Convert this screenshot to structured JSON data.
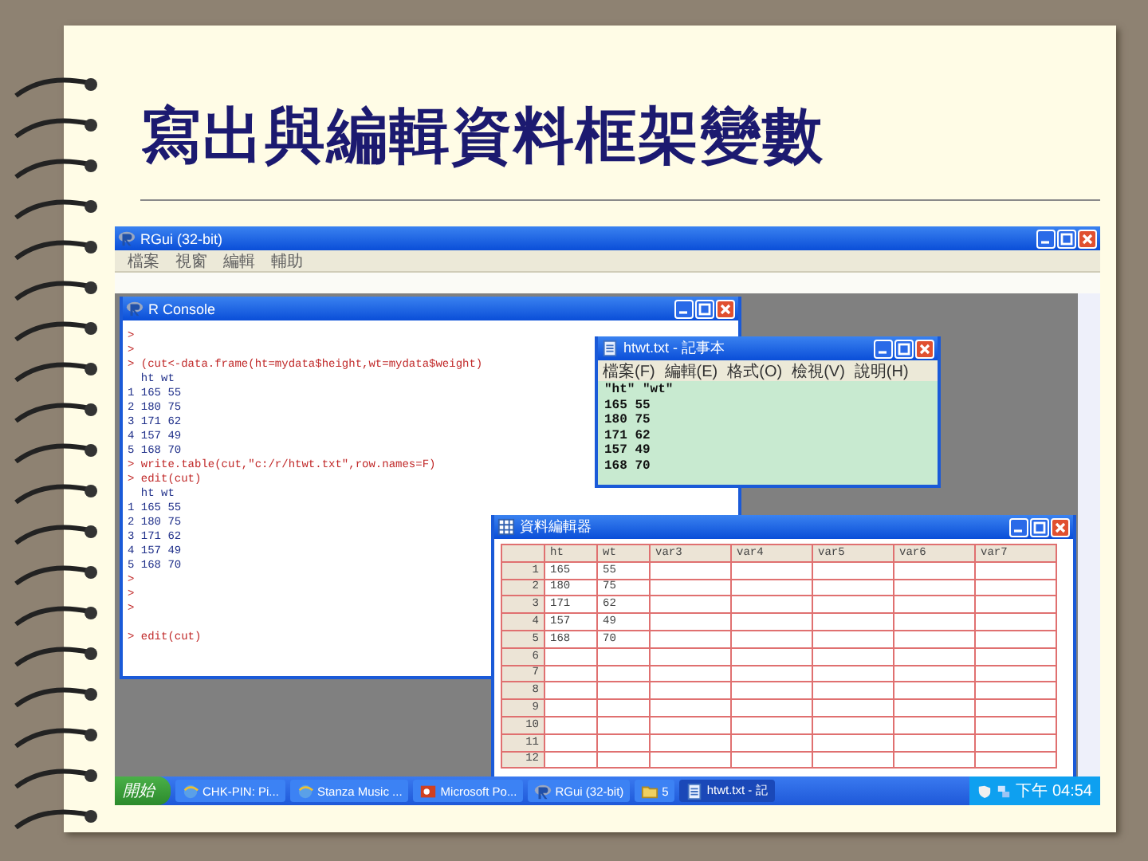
{
  "slide": {
    "title": "寫出與編輯資料框架變數"
  },
  "rgui": {
    "title": "RGui (32-bit)",
    "menu": [
      "檔案",
      "視窗",
      "編輯",
      "輔助"
    ]
  },
  "console": {
    "title": "R Console",
    "lines": [
      {
        "kind": "input",
        "text": ">"
      },
      {
        "kind": "input",
        "text": ">"
      },
      {
        "kind": "input",
        "text": "> (cut<-data.frame(ht=mydata$height,wt=mydata$weight)"
      },
      {
        "kind": "output",
        "text": "  ht wt"
      },
      {
        "kind": "output",
        "text": "1 165 55"
      },
      {
        "kind": "output",
        "text": "2 180 75"
      },
      {
        "kind": "output",
        "text": "3 171 62"
      },
      {
        "kind": "output",
        "text": "4 157 49"
      },
      {
        "kind": "output",
        "text": "5 168 70"
      },
      {
        "kind": "input",
        "text": "> write.table(cut,\"c:/r/htwt.txt\",row.names=F)"
      },
      {
        "kind": "input",
        "text": "> edit(cut)"
      },
      {
        "kind": "output",
        "text": "  ht wt"
      },
      {
        "kind": "output",
        "text": "1 165 55"
      },
      {
        "kind": "output",
        "text": "2 180 75"
      },
      {
        "kind": "output",
        "text": "3 171 62"
      },
      {
        "kind": "output",
        "text": "4 157 49"
      },
      {
        "kind": "output",
        "text": "5 168 70"
      },
      {
        "kind": "input",
        "text": ">"
      },
      {
        "kind": "input",
        "text": ">"
      },
      {
        "kind": "input",
        "text": ">"
      },
      {
        "kind": "blank"
      },
      {
        "kind": "input",
        "text": "> edit(cut)"
      }
    ]
  },
  "notepad": {
    "title": "htwt.txt - 記事本",
    "menu": [
      "檔案(F)",
      "編輯(E)",
      "格式(O)",
      "檢視(V)",
      "說明(H)"
    ],
    "lines": [
      "\"ht\" \"wt\"",
      "165 55",
      "180 75",
      "171 62",
      "157 49",
      "168 70"
    ]
  },
  "data_editor": {
    "title": "資料編輯器",
    "columns": [
      "ht",
      "wt",
      "var3",
      "var4",
      "var5",
      "var6",
      "var7"
    ],
    "rows": [
      {
        "label": "1",
        "cells": [
          "165",
          "55"
        ]
      },
      {
        "label": "2",
        "cells": [
          "180",
          "75"
        ]
      },
      {
        "label": "3",
        "cells": [
          "171",
          "62"
        ]
      },
      {
        "label": "4",
        "cells": [
          "157",
          "49"
        ]
      },
      {
        "label": "5",
        "cells": [
          "168",
          "70"
        ]
      },
      {
        "label": "6",
        "cells": []
      },
      {
        "label": "7",
        "cells": []
      },
      {
        "label": "8",
        "cells": []
      },
      {
        "label": "9",
        "cells": []
      },
      {
        "label": "10",
        "cells": []
      },
      {
        "label": "11",
        "cells": []
      },
      {
        "label": "12",
        "cells": []
      }
    ]
  },
  "taskbar": {
    "start": "開始",
    "tasks": [
      {
        "label": "CHK-PIN: Pi...",
        "kind": "browser",
        "selected": false
      },
      {
        "label": "Stanza Music ...",
        "kind": "browser",
        "selected": false
      },
      {
        "label": "Microsoft Po...",
        "kind": "slides",
        "selected": false
      },
      {
        "label": "RGui (32-bit)",
        "kind": "r",
        "selected": false
      },
      {
        "label": "5",
        "kind": "folder",
        "selected": false
      },
      {
        "label": "htwt.txt - 記",
        "kind": "notepad",
        "selected": true
      }
    ],
    "clock": "下午 04:54"
  }
}
